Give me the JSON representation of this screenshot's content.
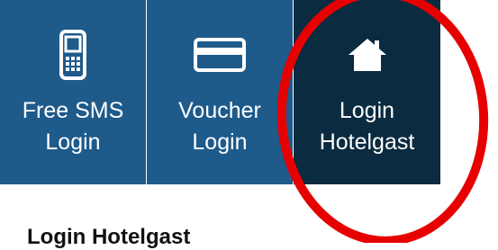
{
  "colors": {
    "tile_blue": "#1e5a8a",
    "tile_dark": "#0b2b40",
    "annotation_red": "#e60000",
    "text_white": "#ffffff"
  },
  "tiles": [
    {
      "id": "sms",
      "icon": "mobile-phone-icon",
      "label_line1": "Free SMS",
      "label_line2": "Login",
      "color": "#1e5a8a"
    },
    {
      "id": "voucher",
      "icon": "credit-card-icon",
      "label_line1": "Voucher",
      "label_line2": "Login",
      "color": "#1e5a8a"
    },
    {
      "id": "hotelgast",
      "icon": "house-icon",
      "label_line1": "Login",
      "label_line2": "Hotelgast",
      "color": "#0b2b40"
    }
  ],
  "section_heading": "Login Hotelgast"
}
